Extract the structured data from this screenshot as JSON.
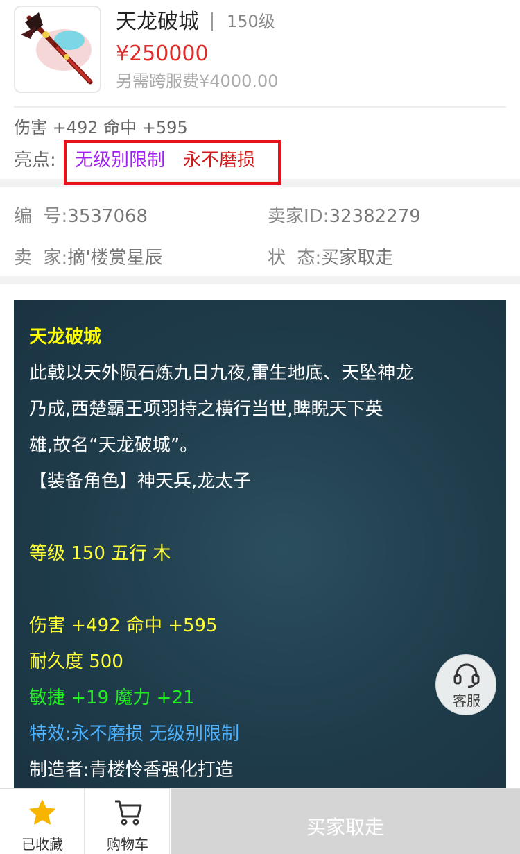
{
  "item": {
    "name": "天龙破城",
    "level": "150级",
    "price": "¥250000",
    "fee": "另需跨服费¥4000.00",
    "attrs": "伤害 +492 命中 +595",
    "highlight_label": "亮点:",
    "highlights": [
      "无级别限制",
      "永不磨损"
    ]
  },
  "info": {
    "number_label": "编  号:",
    "number_value": "3537068",
    "seller_id_label": "卖家ID:",
    "seller_id_value": "32382279",
    "seller_label": "卖  家:",
    "seller_value": "摘'楼赏星辰",
    "status_label": "状  态:",
    "status_value": "买家取走"
  },
  "description": {
    "title": "天龙破城",
    "lines": [
      "此戟以天外陨石炼九日九夜,雷生地底、天坠神龙",
      "乃成,西楚霸王项羽持之横行当世,睥睨天下英",
      "雄,故名“天龙破城”。",
      "【装备角色】神天兵,龙太子"
    ],
    "grade": "等级 150 五行 木",
    "stats": "伤害 +492 命中 +595",
    "durability": "耐久度 500",
    "bonus": "敏捷 +19 魔力 +21",
    "effect": "特效:永不磨损 无级别限制",
    "maker": "制造者:青楼怜香强化打造"
  },
  "service": {
    "label": "客服",
    "icon": "headset-icon"
  },
  "bottom_bar": {
    "favorite_label": "已收藏",
    "cart_label": "购物车",
    "buy_label": "买家取走"
  },
  "colors": {
    "price": "#e02b2b",
    "highlight_purple": "#a020f0",
    "highlight_red": "#d31a1a",
    "panel_bg": "#1f3c4b",
    "title_yellow": "#ffff00",
    "stat_green": "#22ee22",
    "effect_blue": "#4fb3ff",
    "star": "#f7b500"
  }
}
